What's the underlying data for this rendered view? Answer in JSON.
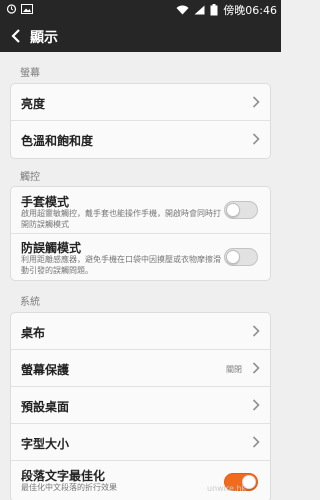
{
  "statusbar": {
    "time_label": "傍晚06:46"
  },
  "appbar": {
    "title": "顯示"
  },
  "sections": {
    "screen": "螢幕",
    "touch": "觸控",
    "system": "系統"
  },
  "screen_items": [
    {
      "label": "亮度"
    },
    {
      "label": "色溫和飽和度"
    }
  ],
  "touch_items": [
    {
      "label": "手套模式",
      "description": "啟用超靈敏觸控，戴手套也能操作手機，開啟時會同時打開防誤觸模式",
      "enabled": false
    },
    {
      "label": "防誤觸模式",
      "description": "利用距離感應器，避免手機在口袋中因摸壓或衣物摩擦滑動引發的誤觸問題。",
      "enabled": false
    }
  ],
  "system_items": [
    {
      "label": "桌布"
    },
    {
      "label": "螢幕保護",
      "value": "關閉"
    },
    {
      "label": "預設桌面"
    },
    {
      "label": "字型大小"
    },
    {
      "label": "段落文字最佳化",
      "description": "最佳化中文段落的折行效果",
      "enabled": true
    }
  ],
  "watermark": "unwire.hk",
  "colors": {
    "accent": "#f26b1d",
    "bar": "#262626",
    "background": "#efefef"
  }
}
